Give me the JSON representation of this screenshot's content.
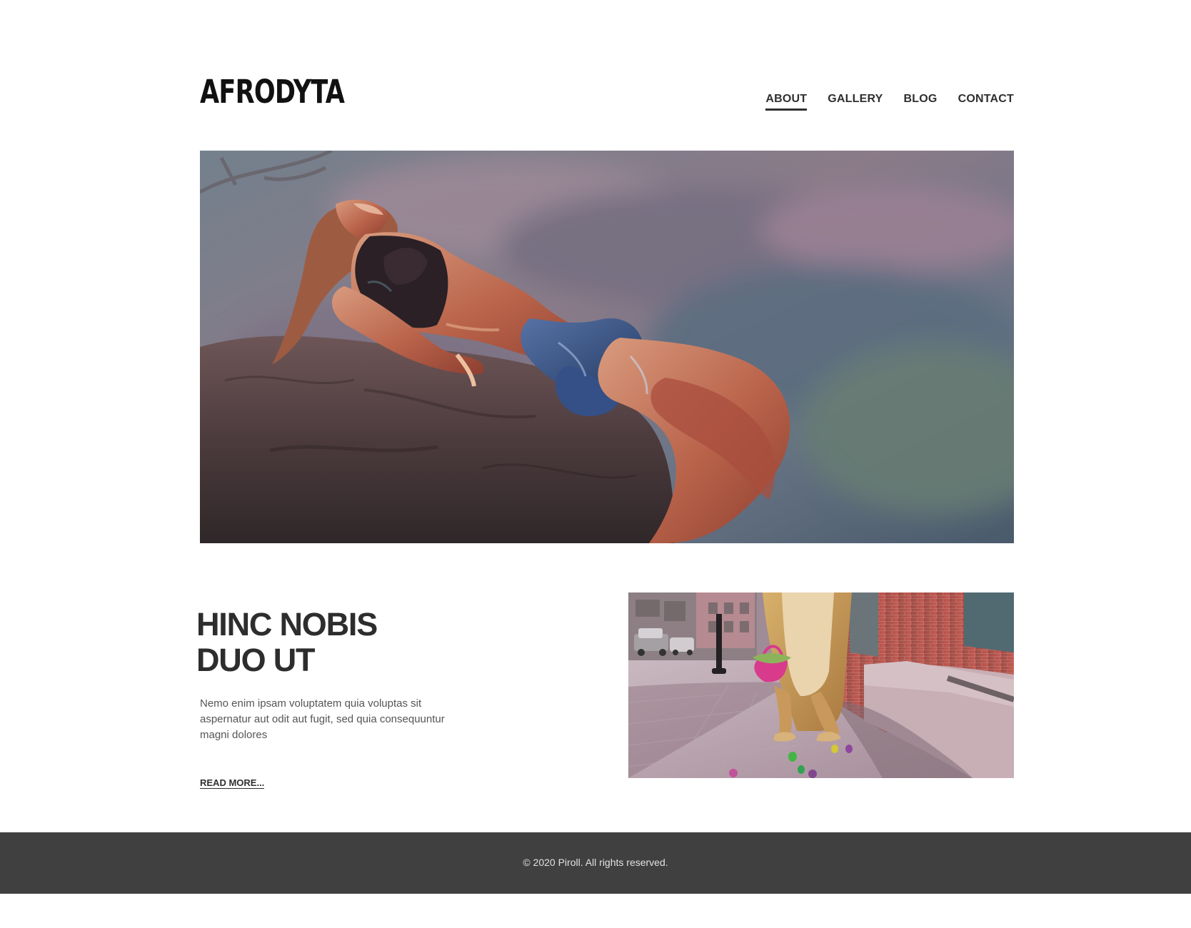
{
  "brand": {
    "name": "AFRODYTA"
  },
  "nav": {
    "items": [
      {
        "label": "ABOUT",
        "active": true
      },
      {
        "label": "GALLERY",
        "active": false
      },
      {
        "label": "BLOG",
        "active": false
      },
      {
        "label": "CONTACT",
        "active": false
      }
    ]
  },
  "hero": {
    "image": "woman-reclining-on-rock"
  },
  "article": {
    "title_line_1": "HINC NOBIS",
    "title_line_2": "DUO UT",
    "body": "Nemo enim ipsam voluptatem quia voluptas sit aspernatur aut odit aut fugit, sed quia consequuntur magni dolores",
    "read_more": "READ MORE..."
  },
  "feature": {
    "image": "bunny-costume-on-sidewalk"
  },
  "footer": {
    "copyright": "© 2020 Piroll. All rights reserved."
  },
  "colors": {
    "text": "#2c2c2c",
    "footer_background": "#404040",
    "footer_text": "#e2e2e2",
    "background": "#ffffff"
  }
}
